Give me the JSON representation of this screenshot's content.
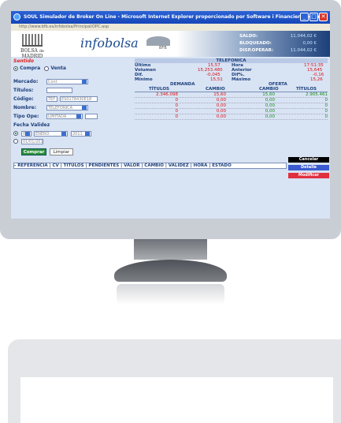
{
  "window": {
    "title": "SOUL Simulador de Broker On Line - Microsoft Internet Explorer proporcionado por Software i Financiero Bolsa",
    "address": "http://www.bfb.es/infobolsa/Principal/OPC.asp"
  },
  "header": {
    "exchange_line1": "BOLSA",
    "exchange_line2": "de",
    "exchange_line3": "MADRID",
    "logo": "infobolsa",
    "bfb": "BFB"
  },
  "account": {
    "saldo_label": "SALDO:",
    "saldo_value": "11.044,02 €",
    "bloqueado_label": "BLOQUEADO:",
    "bloqueado_value": "0,00 €",
    "disp_label": "DISP.OPERAR:",
    "disp_value": "11.044,02 €"
  },
  "form": {
    "section": "Sentido",
    "buy": "Compra",
    "sell": "Venta",
    "mercado_label": "Mercado:",
    "mercado_value": "Cont",
    "titulos_label": "Títulos:",
    "codigo_label": "Código:",
    "codigo_value1": "TEF",
    "codigo_value2": "ES0178430E18",
    "nombre_label": "Nombre:",
    "nombre_value": "TELEFONICA",
    "tipo_label": "Tipo Ope:",
    "tipo_value": "LIMITADA",
    "fecha_label": "Fecha Validez",
    "day": "01",
    "month": "ENERO",
    "year": "2011",
    "date2": "01/01/2011",
    "comprar": "Comprar",
    "limpiar": "Limpiar"
  },
  "quote": {
    "company": "TELEFONICA",
    "ultimo_label": "Último",
    "ultimo_value": "15,57",
    "hora_label": "Hora",
    "hora_value": "17:51:35",
    "volumen_label": "Volumen",
    "volumen_value": "15.253.480",
    "anterior_label": "Anterior",
    "anterior_value": "15,645",
    "dif_label": "Dif.",
    "dif_value": "-0,045",
    "difpct_label": "Dif%.",
    "difpct_value": "-0,16",
    "minimo_label": "Mínimo",
    "minimo_value": "15,51",
    "maximo_label": "Máximo",
    "maximo_value": "15,26",
    "demanda": "DEMANDA",
    "oferta": "OFERTA",
    "col_titulos": "TÍTULOS",
    "col_cambio": "CAMBIO",
    "col_cambio2": "CAMBIO",
    "col_titulos2": "TÍTULOS",
    "book": [
      {
        "dt": "2.346.098",
        "dc": "15,60",
        "oc": "15,60",
        "ot": "2.905.461"
      },
      {
        "dt": "0",
        "dc": "0,00",
        "oc": "0,00",
        "ot": "0"
      },
      {
        "dt": "0",
        "dc": "0,00",
        "oc": "0,00",
        "ot": "0"
      },
      {
        "dt": "0",
        "dc": "0,00",
        "oc": "0,00",
        "ot": "0"
      },
      {
        "dt": "0",
        "dc": "0,00",
        "oc": "0,00",
        "ot": "0"
      }
    ]
  },
  "orders": {
    "headers": "- REFERENCIA | CV | TITULOS | PENDIENTES | VALOR | CAMBIO | VALIDEZ | HORA | ESTADO",
    "cancelar": "Cancelar",
    "detalle": "Detalle",
    "modificar": "Modificar"
  },
  "colors": {
    "accent": "#1c3f7a",
    "buy_button": "#2a8f3a",
    "cancel": "#000000",
    "detail": "#3b5bd0",
    "modify": "#e03040"
  }
}
